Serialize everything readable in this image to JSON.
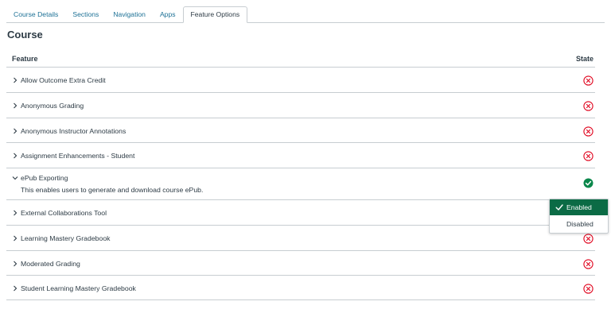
{
  "tabs": [
    {
      "label": "Course Details"
    },
    {
      "label": "Sections"
    },
    {
      "label": "Navigation"
    },
    {
      "label": "Apps"
    },
    {
      "label": "Feature Options"
    }
  ],
  "active_tab": "Feature Options",
  "page_title": "Course",
  "table": {
    "feature_header": "Feature",
    "state_header": "State"
  },
  "features": [
    {
      "label": "Allow Outcome Extra Credit",
      "state": "disabled",
      "expanded": false
    },
    {
      "label": "Anonymous Grading",
      "state": "disabled",
      "expanded": false
    },
    {
      "label": "Anonymous Instructor Annotations",
      "state": "disabled",
      "expanded": false
    },
    {
      "label": "Assignment Enhancements - Student",
      "state": "disabled",
      "expanded": false
    },
    {
      "label": "ePub Exporting",
      "state": "enabled",
      "expanded": true,
      "description": "This enables users to generate and download course ePub."
    },
    {
      "label": "External Collaborations Tool",
      "state": "disabled",
      "expanded": false
    },
    {
      "label": "Learning Mastery Gradebook",
      "state": "disabled",
      "expanded": false
    },
    {
      "label": "Moderated Grading",
      "state": "disabled",
      "expanded": false
    },
    {
      "label": "Student Learning Mastery Gradebook",
      "state": "disabled",
      "expanded": false
    }
  ],
  "state_menu": {
    "options": [
      "Enabled",
      "Disabled"
    ],
    "selected": "Enabled"
  },
  "colors": {
    "tab_link": "#1d7196",
    "enabled_green": "#0b874b",
    "disabled_red": "#e0061f",
    "menu_selected_bg": "#0b6b45",
    "divider": "#c7cdd1"
  }
}
